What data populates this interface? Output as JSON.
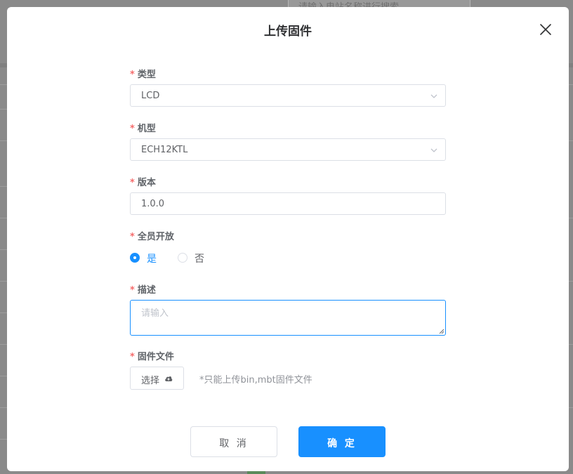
{
  "background": {
    "search_placeholder": "请输入电站名称进行搜索"
  },
  "dialog": {
    "title": "上传固件",
    "required_mark": "*",
    "fields": {
      "type": {
        "label": "类型",
        "value": "LCD"
      },
      "model": {
        "label": "机型",
        "value": "ECH12KTL"
      },
      "version": {
        "label": "版本",
        "value": "1.0.0"
      },
      "open_to_all": {
        "label": "全员开放",
        "options": [
          {
            "label": "是",
            "checked": true
          },
          {
            "label": "否",
            "checked": false
          }
        ]
      },
      "description": {
        "label": "描述",
        "placeholder": "请输入"
      },
      "firmware_file": {
        "label": "固件文件",
        "button_label": "选择",
        "hint": "*只能上传bin,mbt固件文件"
      }
    },
    "footer": {
      "cancel_label": "取 消",
      "confirm_label": "确 定"
    }
  },
  "colors": {
    "primary": "#1890ff",
    "required": "#f56c6c",
    "overlay": "#8a8a8a"
  },
  "icons": {
    "close": "close-icon",
    "dropdown": "chevron-down-icon",
    "upload": "cloud-upload-icon"
  }
}
